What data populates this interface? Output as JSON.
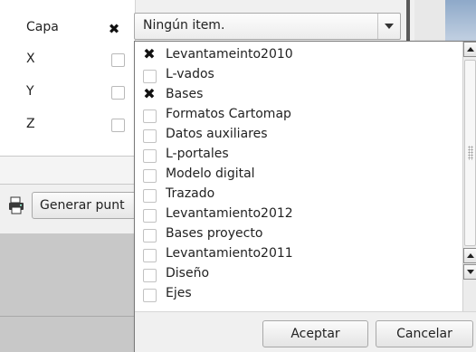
{
  "form": {
    "fields": [
      {
        "label": "Capa",
        "checked": true
      },
      {
        "label": "X",
        "checked": false
      },
      {
        "label": "Y",
        "checked": false
      },
      {
        "label": "Z",
        "checked": false
      }
    ],
    "generate_button_label": "Generar punt",
    "generate_icon": "printer-icon"
  },
  "combo": {
    "selected_text": "Ningún item.",
    "arrow_icon": "chevron-down-icon"
  },
  "dropdown": {
    "items": [
      {
        "label": "Levantameinto2010",
        "checked": true
      },
      {
        "label": "L-vados",
        "checked": false
      },
      {
        "label": "Bases",
        "checked": true
      },
      {
        "label": "Formatos Cartomap",
        "checked": false
      },
      {
        "label": "Datos auxiliares",
        "checked": false
      },
      {
        "label": "L-portales",
        "checked": false
      },
      {
        "label": "Modelo digital",
        "checked": false
      },
      {
        "label": "Trazado",
        "checked": false
      },
      {
        "label": "Levantamiento2012",
        "checked": false
      },
      {
        "label": "Bases proyecto",
        "checked": false
      },
      {
        "label": "Levantamiento2011",
        "checked": false
      },
      {
        "label": "Diseño",
        "checked": false
      },
      {
        "label": "Ejes",
        "checked": false
      }
    ],
    "accept_label": "Aceptar",
    "cancel_label": "Cancelar"
  },
  "colors": {
    "check_mark": "#111111",
    "panel_background": "#f0f0f0",
    "gray_area": "#c8c8c8"
  }
}
